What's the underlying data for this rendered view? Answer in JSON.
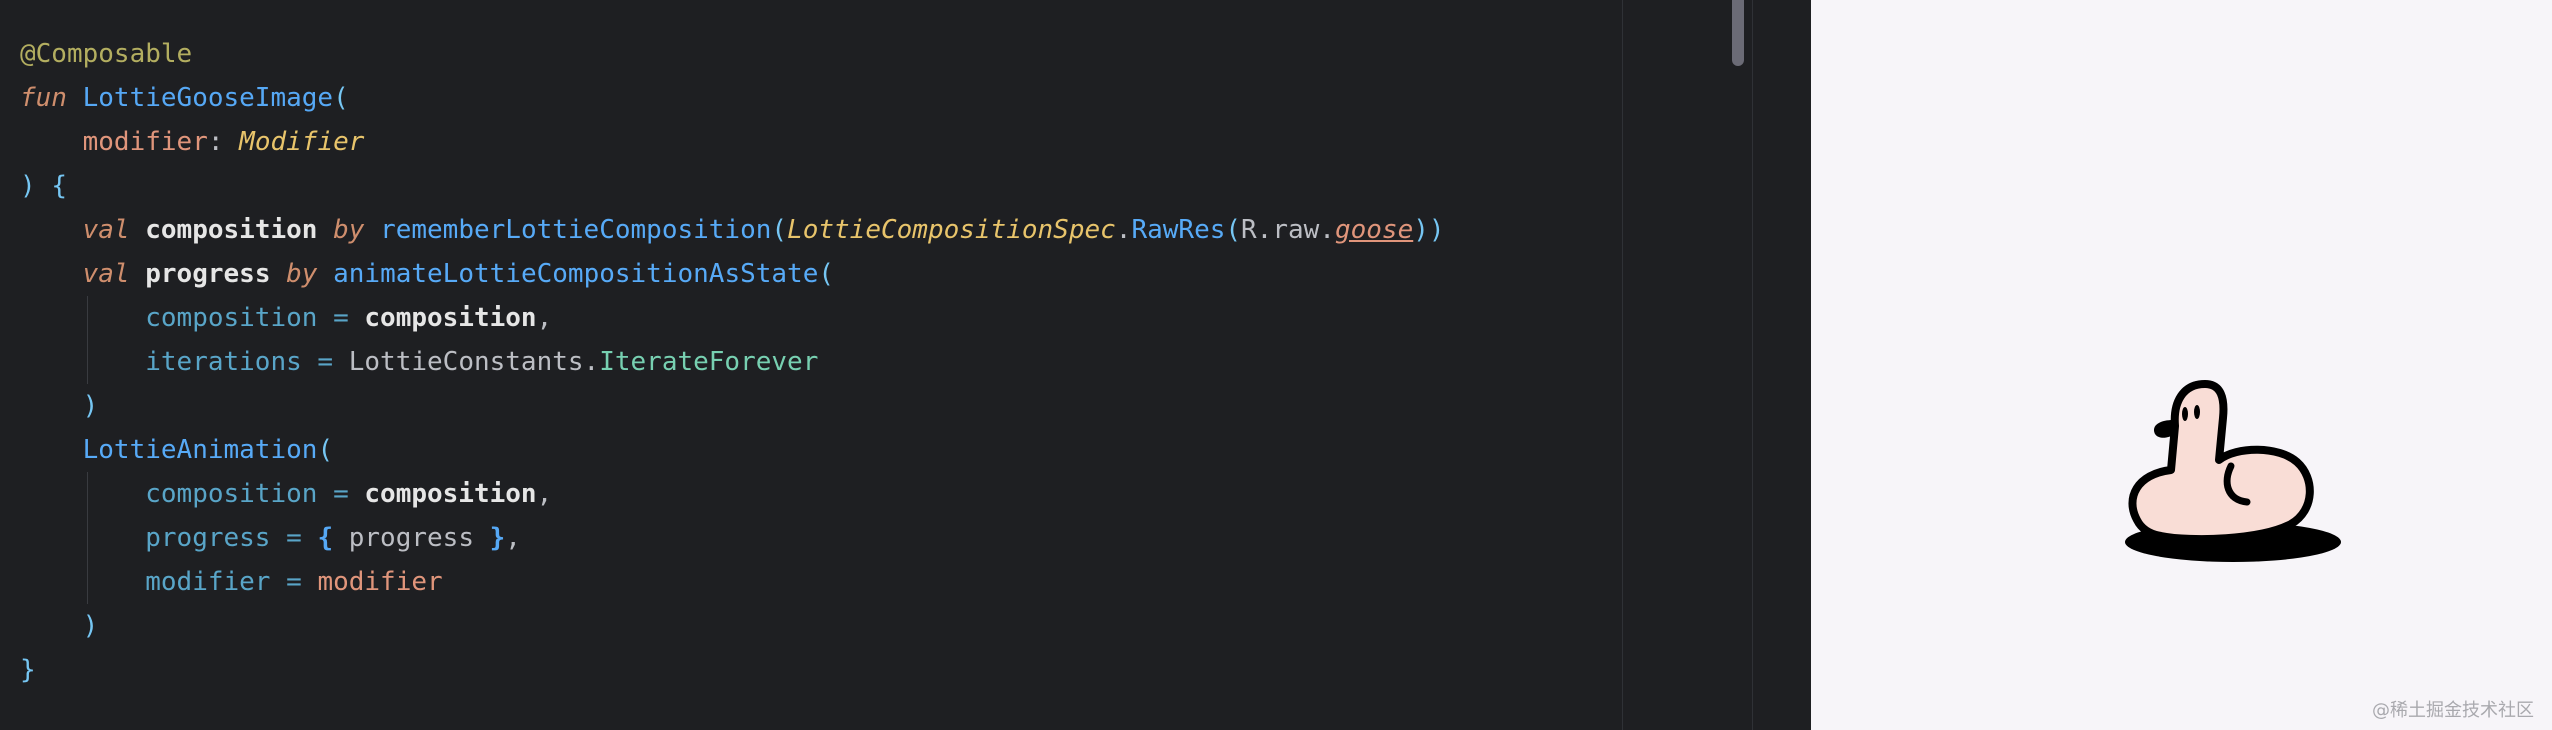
{
  "editor": {
    "lines": [
      {
        "indent": 0,
        "tokens": [
          {
            "t": "@Composable",
            "c": "annot"
          }
        ]
      },
      {
        "indent": 0,
        "tokens": [
          {
            "t": "fun",
            "c": "kwi"
          },
          {
            "t": " "
          },
          {
            "t": "LottieGooseImage",
            "c": "fn"
          },
          {
            "t": "(",
            "c": "paren"
          }
        ]
      },
      {
        "indent": 1,
        "tokens": [
          {
            "t": "modifier",
            "c": "param"
          },
          {
            "t": ": "
          },
          {
            "t": "Modifier",
            "c": "type"
          }
        ]
      },
      {
        "indent": 0,
        "tokens": [
          {
            "t": ")",
            "c": "paren"
          },
          {
            "t": " "
          },
          {
            "t": "{",
            "c": "paren"
          }
        ]
      },
      {
        "indent": 1,
        "tokens": [
          {
            "t": "val",
            "c": "kwi"
          },
          {
            "t": " "
          },
          {
            "t": "composition",
            "c": "var"
          },
          {
            "t": " "
          },
          {
            "t": "by",
            "c": "kwi"
          },
          {
            "t": " "
          },
          {
            "t": "rememberLottieComposition",
            "c": "fncall"
          },
          {
            "t": "(",
            "c": "paren"
          },
          {
            "t": "LottieCompositionSpec",
            "c": "type"
          },
          {
            "t": "."
          },
          {
            "t": "RawRes",
            "c": "fncall"
          },
          {
            "t": "(",
            "c": "paren"
          },
          {
            "t": "R.raw."
          },
          {
            "t": "goose",
            "c": "res"
          },
          {
            "t": "))",
            "c": "paren"
          }
        ]
      },
      {
        "indent": 1,
        "tokens": [
          {
            "t": "val",
            "c": "kwi"
          },
          {
            "t": " "
          },
          {
            "t": "progress",
            "c": "var"
          },
          {
            "t": " "
          },
          {
            "t": "by",
            "c": "kwi"
          },
          {
            "t": " "
          },
          {
            "t": "animateLottieCompositionAsState",
            "c": "fncall"
          },
          {
            "t": "(",
            "c": "paren"
          }
        ]
      },
      {
        "indent": 2,
        "tokens": [
          {
            "t": "composition",
            "c": "named"
          },
          {
            "t": " = ",
            "c": "named"
          },
          {
            "t": "composition",
            "c": "var"
          },
          {
            "t": ","
          }
        ]
      },
      {
        "indent": 2,
        "tokens": [
          {
            "t": "iterations",
            "c": "named"
          },
          {
            "t": " = ",
            "c": "named"
          },
          {
            "t": "LottieConstants."
          },
          {
            "t": "IterateForever",
            "c": "const"
          }
        ]
      },
      {
        "indent": 1,
        "tokens": [
          {
            "t": ")",
            "c": "paren"
          }
        ]
      },
      {
        "indent": 1,
        "tokens": [
          {
            "t": "LottieAnimation",
            "c": "fncall"
          },
          {
            "t": "(",
            "c": "paren"
          }
        ]
      },
      {
        "indent": 2,
        "tokens": [
          {
            "t": "composition",
            "c": "named"
          },
          {
            "t": " = ",
            "c": "named"
          },
          {
            "t": "composition",
            "c": "var"
          },
          {
            "t": ","
          }
        ]
      },
      {
        "indent": 2,
        "tokens": [
          {
            "t": "progress",
            "c": "named"
          },
          {
            "t": " = ",
            "c": "named"
          },
          {
            "t": "{",
            "c": "brace"
          },
          {
            "t": " progress "
          },
          {
            "t": "}",
            "c": "brace"
          },
          {
            "t": ","
          }
        ]
      },
      {
        "indent": 2,
        "tokens": [
          {
            "t": "modifier",
            "c": "named"
          },
          {
            "t": " = ",
            "c": "named"
          },
          {
            "t": "modifier",
            "c": "param"
          }
        ]
      },
      {
        "indent": 1,
        "tokens": [
          {
            "t": ")",
            "c": "paren"
          }
        ]
      },
      {
        "indent": 0,
        "tokens": [
          {
            "t": "}",
            "c": "paren"
          }
        ]
      }
    ]
  },
  "preview": {
    "image": "goose-animation",
    "watermark": "@稀土掘金技术社区"
  },
  "colors": {
    "editor_bg": "#1e1f22",
    "preview_bg": "#f7f5f9",
    "goose_fill": "#f9ddd6",
    "goose_outline": "#000000"
  }
}
